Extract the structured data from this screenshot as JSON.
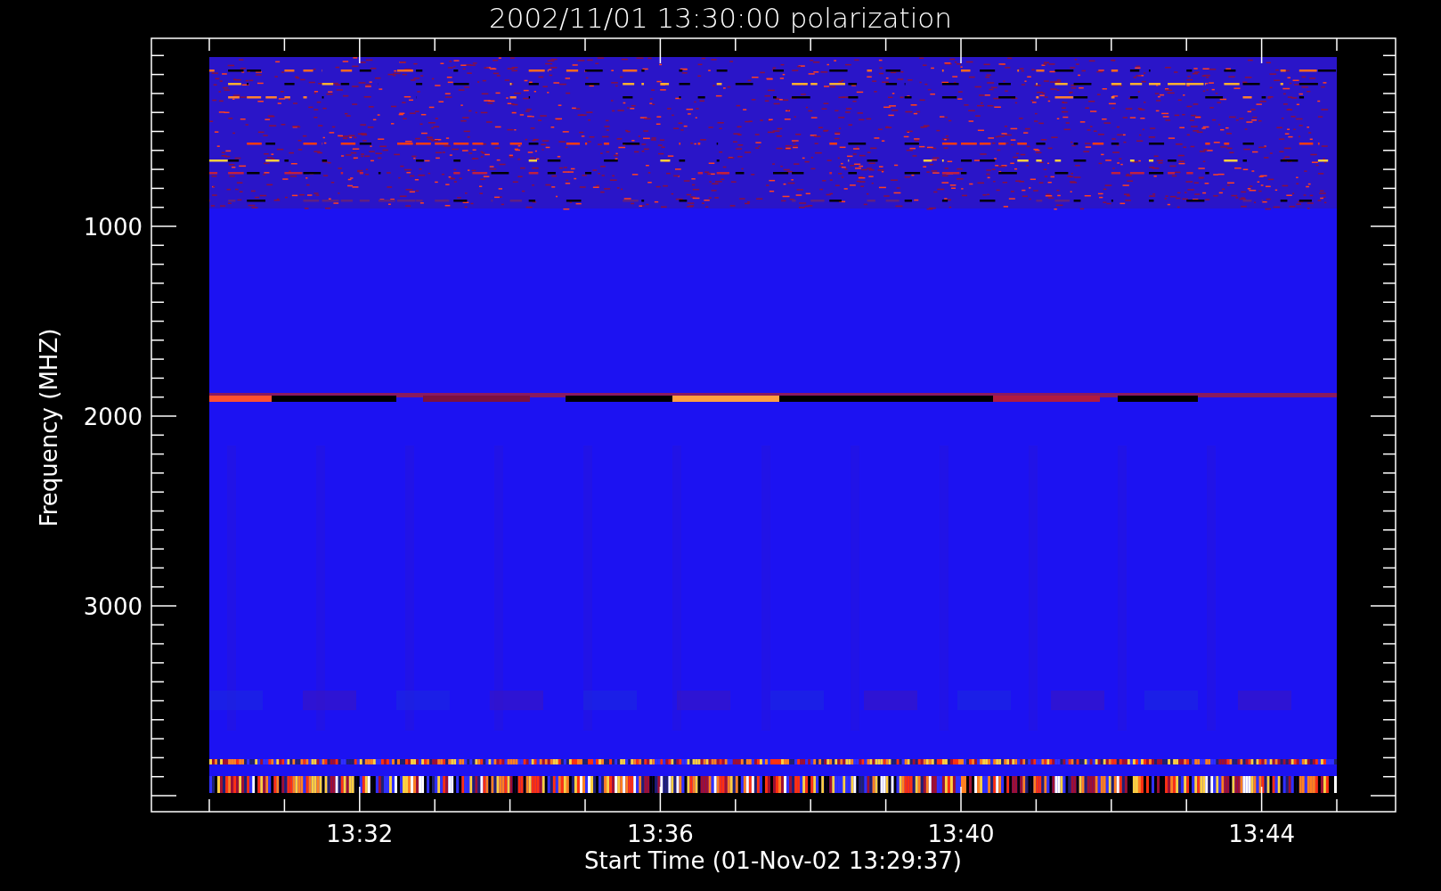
{
  "title": "2002/11/01 13:30:00 polarization",
  "plot": {
    "ylabel": "Frequency (MHZ)",
    "xlabel": "Start Time (01-Nov-02 13:29:37)",
    "y_tick_labels": [
      "1000",
      "2000",
      "3000"
    ],
    "x_tick_labels": [
      "13:32",
      "13:36",
      "13:40",
      "13:44"
    ]
  }
}
